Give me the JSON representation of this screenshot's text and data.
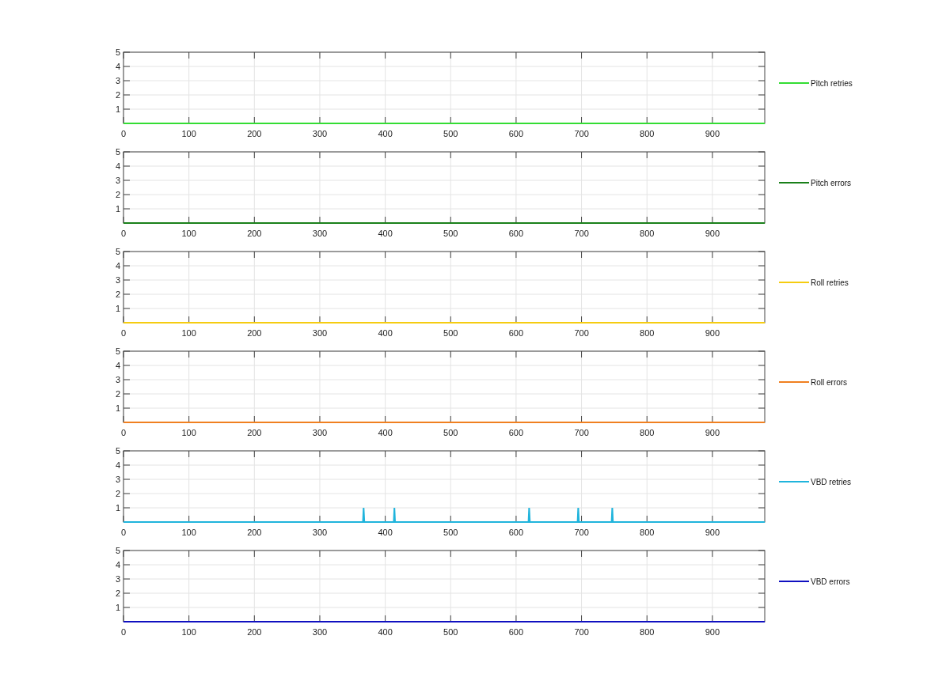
{
  "figure": {
    "panels": [
      {
        "chart_data": {
          "type": "line",
          "grid": true,
          "xlim": [
            0,
            980
          ],
          "ylim": [
            0,
            5
          ],
          "xticks": [
            0,
            100,
            200,
            300,
            400,
            500,
            600,
            700,
            800,
            900
          ],
          "yticks": [
            1,
            2,
            3,
            4,
            5
          ],
          "x": [
            0,
            980
          ],
          "series": [
            {
              "name": "Pitch retries",
              "color": "#33dd33",
              "values": [
                0,
                0
              ]
            }
          ]
        }
      },
      {
        "chart_data": {
          "type": "line",
          "grid": true,
          "xlim": [
            0,
            980
          ],
          "ylim": [
            0,
            5
          ],
          "xticks": [
            0,
            100,
            200,
            300,
            400,
            500,
            600,
            700,
            800,
            900
          ],
          "yticks": [
            1,
            2,
            3,
            4,
            5
          ],
          "x": [
            0,
            980
          ],
          "series": [
            {
              "name": "Pitch errors",
              "color": "#1a801a",
              "values": [
                0,
                0
              ]
            }
          ]
        }
      },
      {
        "chart_data": {
          "type": "line",
          "grid": true,
          "xlim": [
            0,
            980
          ],
          "ylim": [
            0,
            5
          ],
          "xticks": [
            0,
            100,
            200,
            300,
            400,
            500,
            600,
            700,
            800,
            900
          ],
          "yticks": [
            1,
            2,
            3,
            4,
            5
          ],
          "x": [
            0,
            980
          ],
          "series": [
            {
              "name": "Roll retries",
              "color": "#f5cc10",
              "values": [
                0,
                0
              ]
            }
          ]
        }
      },
      {
        "chart_data": {
          "type": "line",
          "grid": true,
          "xlim": [
            0,
            980
          ],
          "ylim": [
            0,
            5
          ],
          "xticks": [
            0,
            100,
            200,
            300,
            400,
            500,
            600,
            700,
            800,
            900
          ],
          "yticks": [
            1,
            2,
            3,
            4,
            5
          ],
          "x": [
            0,
            980
          ],
          "series": [
            {
              "name": "Roll errors",
              "color": "#f08020",
              "values": [
                0,
                0
              ]
            }
          ]
        }
      },
      {
        "chart_data": {
          "type": "line",
          "grid": true,
          "xlim": [
            0,
            980
          ],
          "ylim": [
            0,
            5
          ],
          "xticks": [
            0,
            100,
            200,
            300,
            400,
            500,
            600,
            700,
            800,
            900
          ],
          "yticks": [
            1,
            2,
            3,
            4,
            5
          ],
          "x": [
            0,
            366,
            367,
            368,
            413,
            414,
            415,
            619,
            620,
            621,
            694,
            695,
            696,
            746,
            747,
            748,
            980
          ],
          "series": [
            {
              "name": "VBD retries",
              "color": "#20b4dc",
              "values": [
                0,
                0,
                1,
                0,
                0,
                1,
                0,
                0,
                1,
                0,
                0,
                1,
                0,
                0,
                1,
                0,
                0
              ]
            }
          ]
        }
      },
      {
        "chart_data": {
          "type": "line",
          "grid": true,
          "xlim": [
            0,
            980
          ],
          "ylim": [
            0,
            5
          ],
          "xticks": [
            0,
            100,
            200,
            300,
            400,
            500,
            600,
            700,
            800,
            900
          ],
          "yticks": [
            1,
            2,
            3,
            4,
            5
          ],
          "x": [
            0,
            980
          ],
          "series": [
            {
              "name": "VBD errors",
              "color": "#1010c0",
              "values": [
                0,
                0
              ]
            }
          ]
        }
      }
    ]
  }
}
